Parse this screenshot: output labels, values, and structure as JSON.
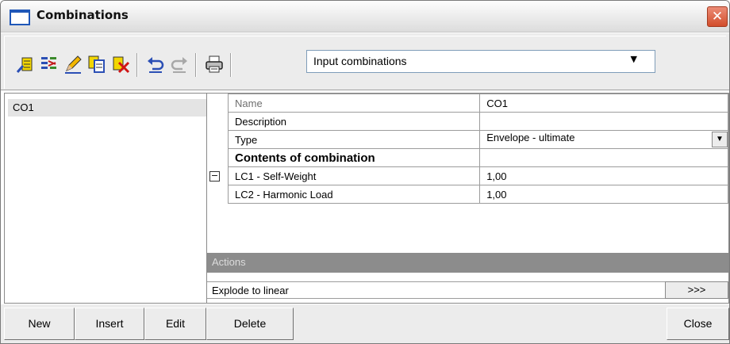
{
  "window": {
    "title": "Combinations",
    "close_glyph": "✕"
  },
  "toolbar": {
    "icons": [
      "new-combination-icon",
      "generate-icon",
      "edit-pencil-icon",
      "copy-icon",
      "delete-icon",
      "undo-icon",
      "redo-icon",
      "print-icon"
    ],
    "combo_value": "Input combinations",
    "combo_arrow": "▼"
  },
  "list": {
    "items": [
      "CO1"
    ]
  },
  "properties": {
    "rows": [
      {
        "name": "Name",
        "value": "CO1"
      },
      {
        "name": "Description",
        "value": ""
      },
      {
        "name": "Type",
        "value": "Envelope - ultimate"
      },
      {
        "name": "Contents of combination",
        "value": ""
      },
      {
        "name": "LC1 - Self-Weight",
        "value": "1,00"
      },
      {
        "name": "LC2 - Harmonic Load",
        "value": "1,00"
      }
    ],
    "collapse_glyph": "−",
    "dropdown_glyph": "▼"
  },
  "actions": {
    "header": "Actions",
    "explode_label": "Explode to linear",
    "explode_button": ">>>"
  },
  "buttons": {
    "new": "New",
    "insert": "Insert",
    "edit": "Edit",
    "delete": "Delete",
    "close": "Close"
  },
  "colors": {
    "title_icon_border": "#1f57b8",
    "close_button": "#d24d2b",
    "actions_header_bg": "#8c8c8c",
    "selected_item_bg": "#e4e4e4"
  }
}
